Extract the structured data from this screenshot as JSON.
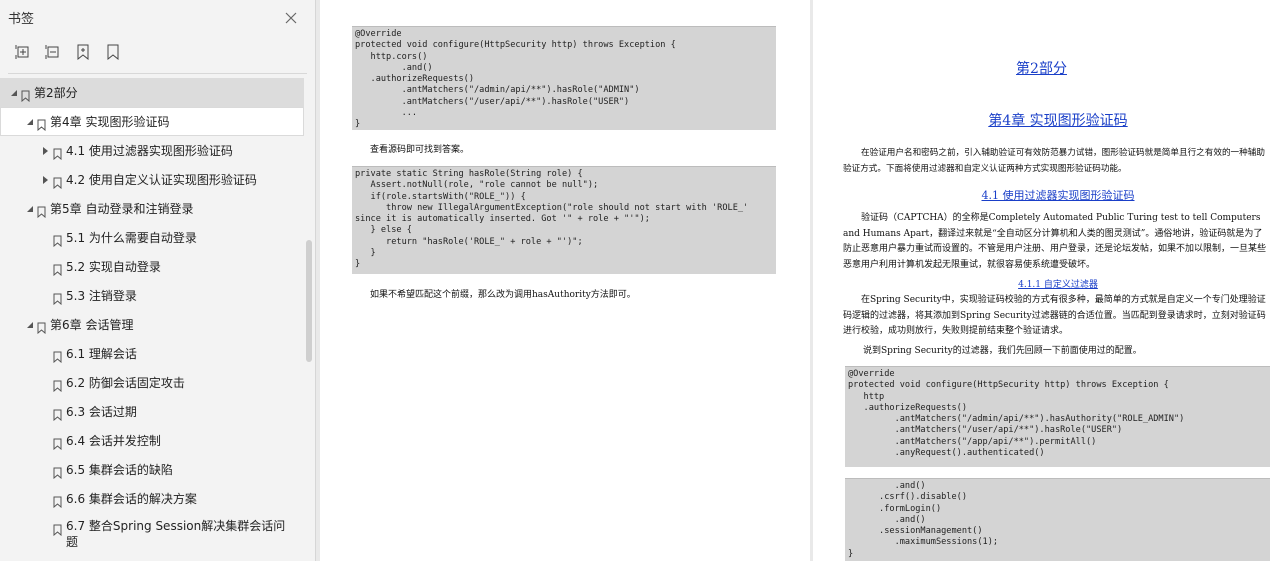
{
  "sidebar": {
    "title": "书签",
    "items": [
      {
        "label": "第2部分"
      },
      {
        "label": "第4章 实现图形验证码"
      },
      {
        "label": "4.1 使用过滤器实现图形验证码"
      },
      {
        "label": "4.2 使用自定义认证实现图形验证码"
      },
      {
        "label": "第5章 自动登录和注销登录"
      },
      {
        "label": "5.1 为什么需要自动登录"
      },
      {
        "label": "5.2 实现自动登录"
      },
      {
        "label": "5.3 注销登录"
      },
      {
        "label": "第6章 会话管理"
      },
      {
        "label": "6.1 理解会话"
      },
      {
        "label": "6.2 防御会话固定攻击"
      },
      {
        "label": "6.3 会话过期"
      },
      {
        "label": "6.4 会话并发控制"
      },
      {
        "label": "6.5 集群会话的缺陷"
      },
      {
        "label": "6.6 集群会话的解决方案"
      },
      {
        "label": "6.7 整合Spring Session解决集群会话问题"
      }
    ]
  },
  "page1": {
    "code1": "@Override\nprotected void configure(HttpSecurity http) throws Exception {\n   http.cors()\n         .and()\n   .authorizeRequests()\n         .antMatchers(\"/admin/api/**\").hasRole(\"ADMIN\")\n         .antMatchers(\"/user/api/**\").hasRole(\"USER\")\n         ...\n}",
    "text1": "查看源码即可找到答案。",
    "code2": "private static String hasRole(String role) {\n   Assert.notNull(role, \"role cannot be null\");\n   if(role.startsWith(\"ROLE_\")) {\n      throw new IllegalArgumentException(\"role should not start with 'ROLE_'\nsince it is automatically inserted. Got '\" + role + \"'\");\n   } else {\n      return \"hasRole('ROLE_\" + role + \"')\";\n   }\n}",
    "text2": "如果不希望匹配这个前缀，那么改为调用hasAuthority方法即可。"
  },
  "page2": {
    "part_title": "第2部分",
    "chapter_title": "第4章 实现图形验证码",
    "intro": "在验证用户名和密码之前，引入辅助验证可有效防范暴力试错，图形验证码就是简单且行之有效的一种辅助验证方式。下面将使用过滤器和自定义认证两种方式实现图形验证码功能。",
    "section_41": "4.1 使用过滤器实现图形验证码",
    "para1": "验证码（CAPTCHA）的全称是Completely Automated Public Turing test to tell Computers and Humans Apart，翻译过来就是“全自动区分计算机和人类的图灵测试”。通俗地讲，验证码就是为了防止恶意用户暴力重试而设置的。不管是用户注册、用户登录，还是论坛发帖，如果不加以限制，一旦某些恶意用户利用计算机发起无限重试，就很容易使系统遭受破坏。",
    "section_411": "4.1.1 自定义过滤器",
    "para2": "在Spring Security中，实现验证码校验的方式有很多种，最简单的方式就是自定义一个专门处理验证码逻辑的过滤器，将其添加到Spring Security过滤器链的合适位置。当匹配到登录请求时，立刻对验证码进行校验，成功则放行，失败则提前结束整个验证请求。",
    "para3": "说到Spring Security的过滤器，我们先回顾一下前面使用过的配置。",
    "code1": "@Override\nprotected void configure(HttpSecurity http) throws Exception {\n   http\n   .authorizeRequests()\n         .antMatchers(\"/admin/api/**\").hasAuthority(\"ROLE_ADMIN\")\n         .antMatchers(\"/user/api/**\").hasRole(\"USER\")\n         .antMatchers(\"/app/api/**\").permitAll()\n         .anyRequest().authenticated()",
    "code2": "         .and()\n      .csrf().disable()\n      .formLogin()\n         .and()\n      .sessionManagement()\n         .maximumSessions(1);\n}"
  }
}
